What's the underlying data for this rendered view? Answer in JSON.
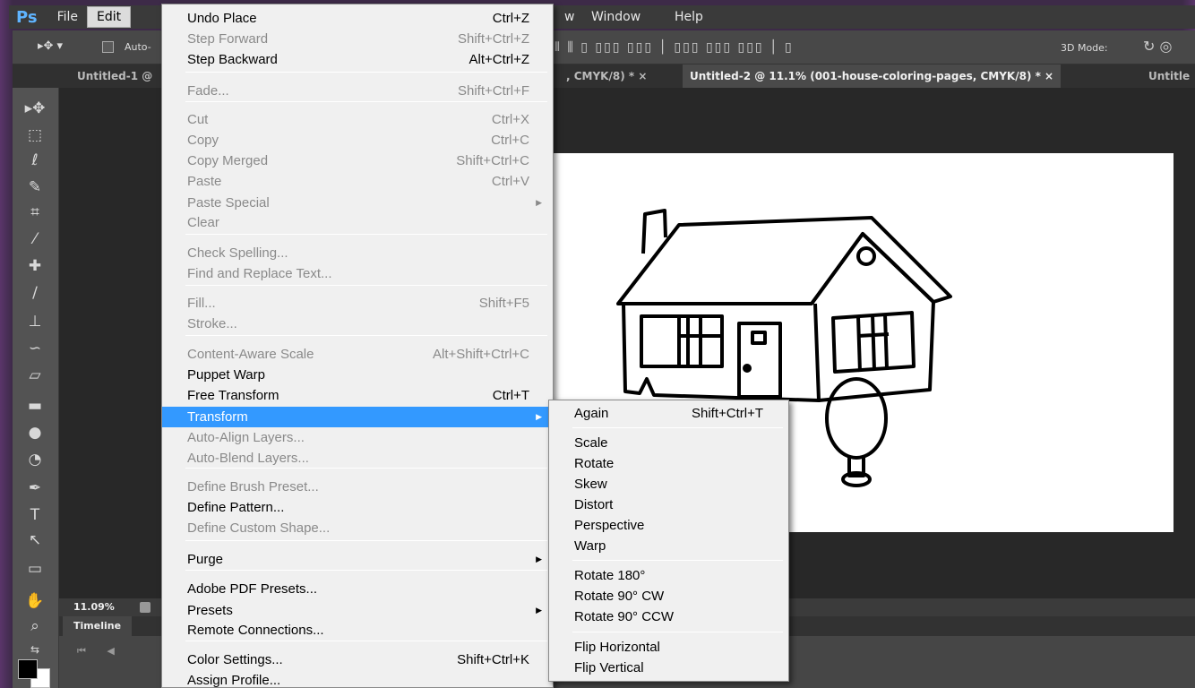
{
  "app": {
    "logo": "Ps"
  },
  "menubar": {
    "items": [
      "File",
      "Edit",
      "w",
      "Window",
      "Help"
    ]
  },
  "options_bar": {
    "auto_select_label": "Auto-",
    "mode_label": "3D Mode:"
  },
  "tabs": [
    {
      "label": "Untitled-1 @"
    },
    {
      "label": ", CMYK/8) *  ×"
    },
    {
      "label": "Untitled-2 @ 11.1% (001-house-coloring-pages, CMYK/8) *  ×"
    },
    {
      "label": "Untitle"
    }
  ],
  "status": {
    "zoom": "11.09%"
  },
  "timeline": {
    "title": "Timeline"
  },
  "edit_menu": [
    {
      "label": "Undo Place",
      "shortcut": "Ctrl+Z",
      "enabled": true
    },
    {
      "label": "Step Forward",
      "shortcut": "Shift+Ctrl+Z",
      "enabled": false
    },
    {
      "label": "Step Backward",
      "shortcut": "Alt+Ctrl+Z",
      "enabled": true
    },
    {
      "label": "Fade...",
      "shortcut": "Shift+Ctrl+F",
      "enabled": false
    },
    {
      "label": "Cut",
      "shortcut": "Ctrl+X",
      "enabled": false
    },
    {
      "label": "Copy",
      "shortcut": "Ctrl+C",
      "enabled": false
    },
    {
      "label": "Copy Merged",
      "shortcut": "Shift+Ctrl+C",
      "enabled": false
    },
    {
      "label": "Paste",
      "shortcut": "Ctrl+V",
      "enabled": false
    },
    {
      "label": "Paste Special",
      "shortcut": "",
      "enabled": false
    },
    {
      "label": "Clear",
      "shortcut": "",
      "enabled": false
    },
    {
      "label": "Check Spelling...",
      "shortcut": "",
      "enabled": false
    },
    {
      "label": "Find and Replace Text...",
      "shortcut": "",
      "enabled": false
    },
    {
      "label": "Fill...",
      "shortcut": "Shift+F5",
      "enabled": false
    },
    {
      "label": "Stroke...",
      "shortcut": "",
      "enabled": false
    },
    {
      "label": "Content-Aware Scale",
      "shortcut": "Alt+Shift+Ctrl+C",
      "enabled": false
    },
    {
      "label": "Puppet Warp",
      "shortcut": "",
      "enabled": true
    },
    {
      "label": "Free Transform",
      "shortcut": "Ctrl+T",
      "enabled": true
    },
    {
      "label": "Transform",
      "shortcut": "",
      "enabled": true
    },
    {
      "label": "Auto-Align Layers...",
      "shortcut": "",
      "enabled": false
    },
    {
      "label": "Auto-Blend Layers...",
      "shortcut": "",
      "enabled": false
    },
    {
      "label": "Define Brush Preset...",
      "shortcut": "",
      "enabled": false
    },
    {
      "label": "Define Pattern...",
      "shortcut": "",
      "enabled": true
    },
    {
      "label": "Define Custom Shape...",
      "shortcut": "",
      "enabled": false
    },
    {
      "label": "Purge",
      "shortcut": "",
      "enabled": true
    },
    {
      "label": "Adobe PDF Presets...",
      "shortcut": "",
      "enabled": true
    },
    {
      "label": "Presets",
      "shortcut": "",
      "enabled": true
    },
    {
      "label": "Remote Connections...",
      "shortcut": "",
      "enabled": true
    },
    {
      "label": "Color Settings...",
      "shortcut": "Shift+Ctrl+K",
      "enabled": true
    },
    {
      "label": "Assign Profile...",
      "shortcut": "",
      "enabled": true
    }
  ],
  "transform_submenu": [
    {
      "label": "Again",
      "shortcut": "Shift+Ctrl+T"
    },
    {
      "label": "Scale",
      "shortcut": ""
    },
    {
      "label": "Rotate",
      "shortcut": ""
    },
    {
      "label": "Skew",
      "shortcut": ""
    },
    {
      "label": "Distort",
      "shortcut": ""
    },
    {
      "label": "Perspective",
      "shortcut": ""
    },
    {
      "label": "Warp",
      "shortcut": ""
    },
    {
      "label": "Rotate 180°",
      "shortcut": ""
    },
    {
      "label": "Rotate 90° CW",
      "shortcut": ""
    },
    {
      "label": "Rotate 90° CCW",
      "shortcut": ""
    },
    {
      "label": "Flip Horizontal",
      "shortcut": ""
    },
    {
      "label": "Flip Vertical",
      "shortcut": ""
    }
  ],
  "colors": {
    "highlight": "#3399ff",
    "menu_bg": "#f0f0f0",
    "workspace": "#282828"
  }
}
